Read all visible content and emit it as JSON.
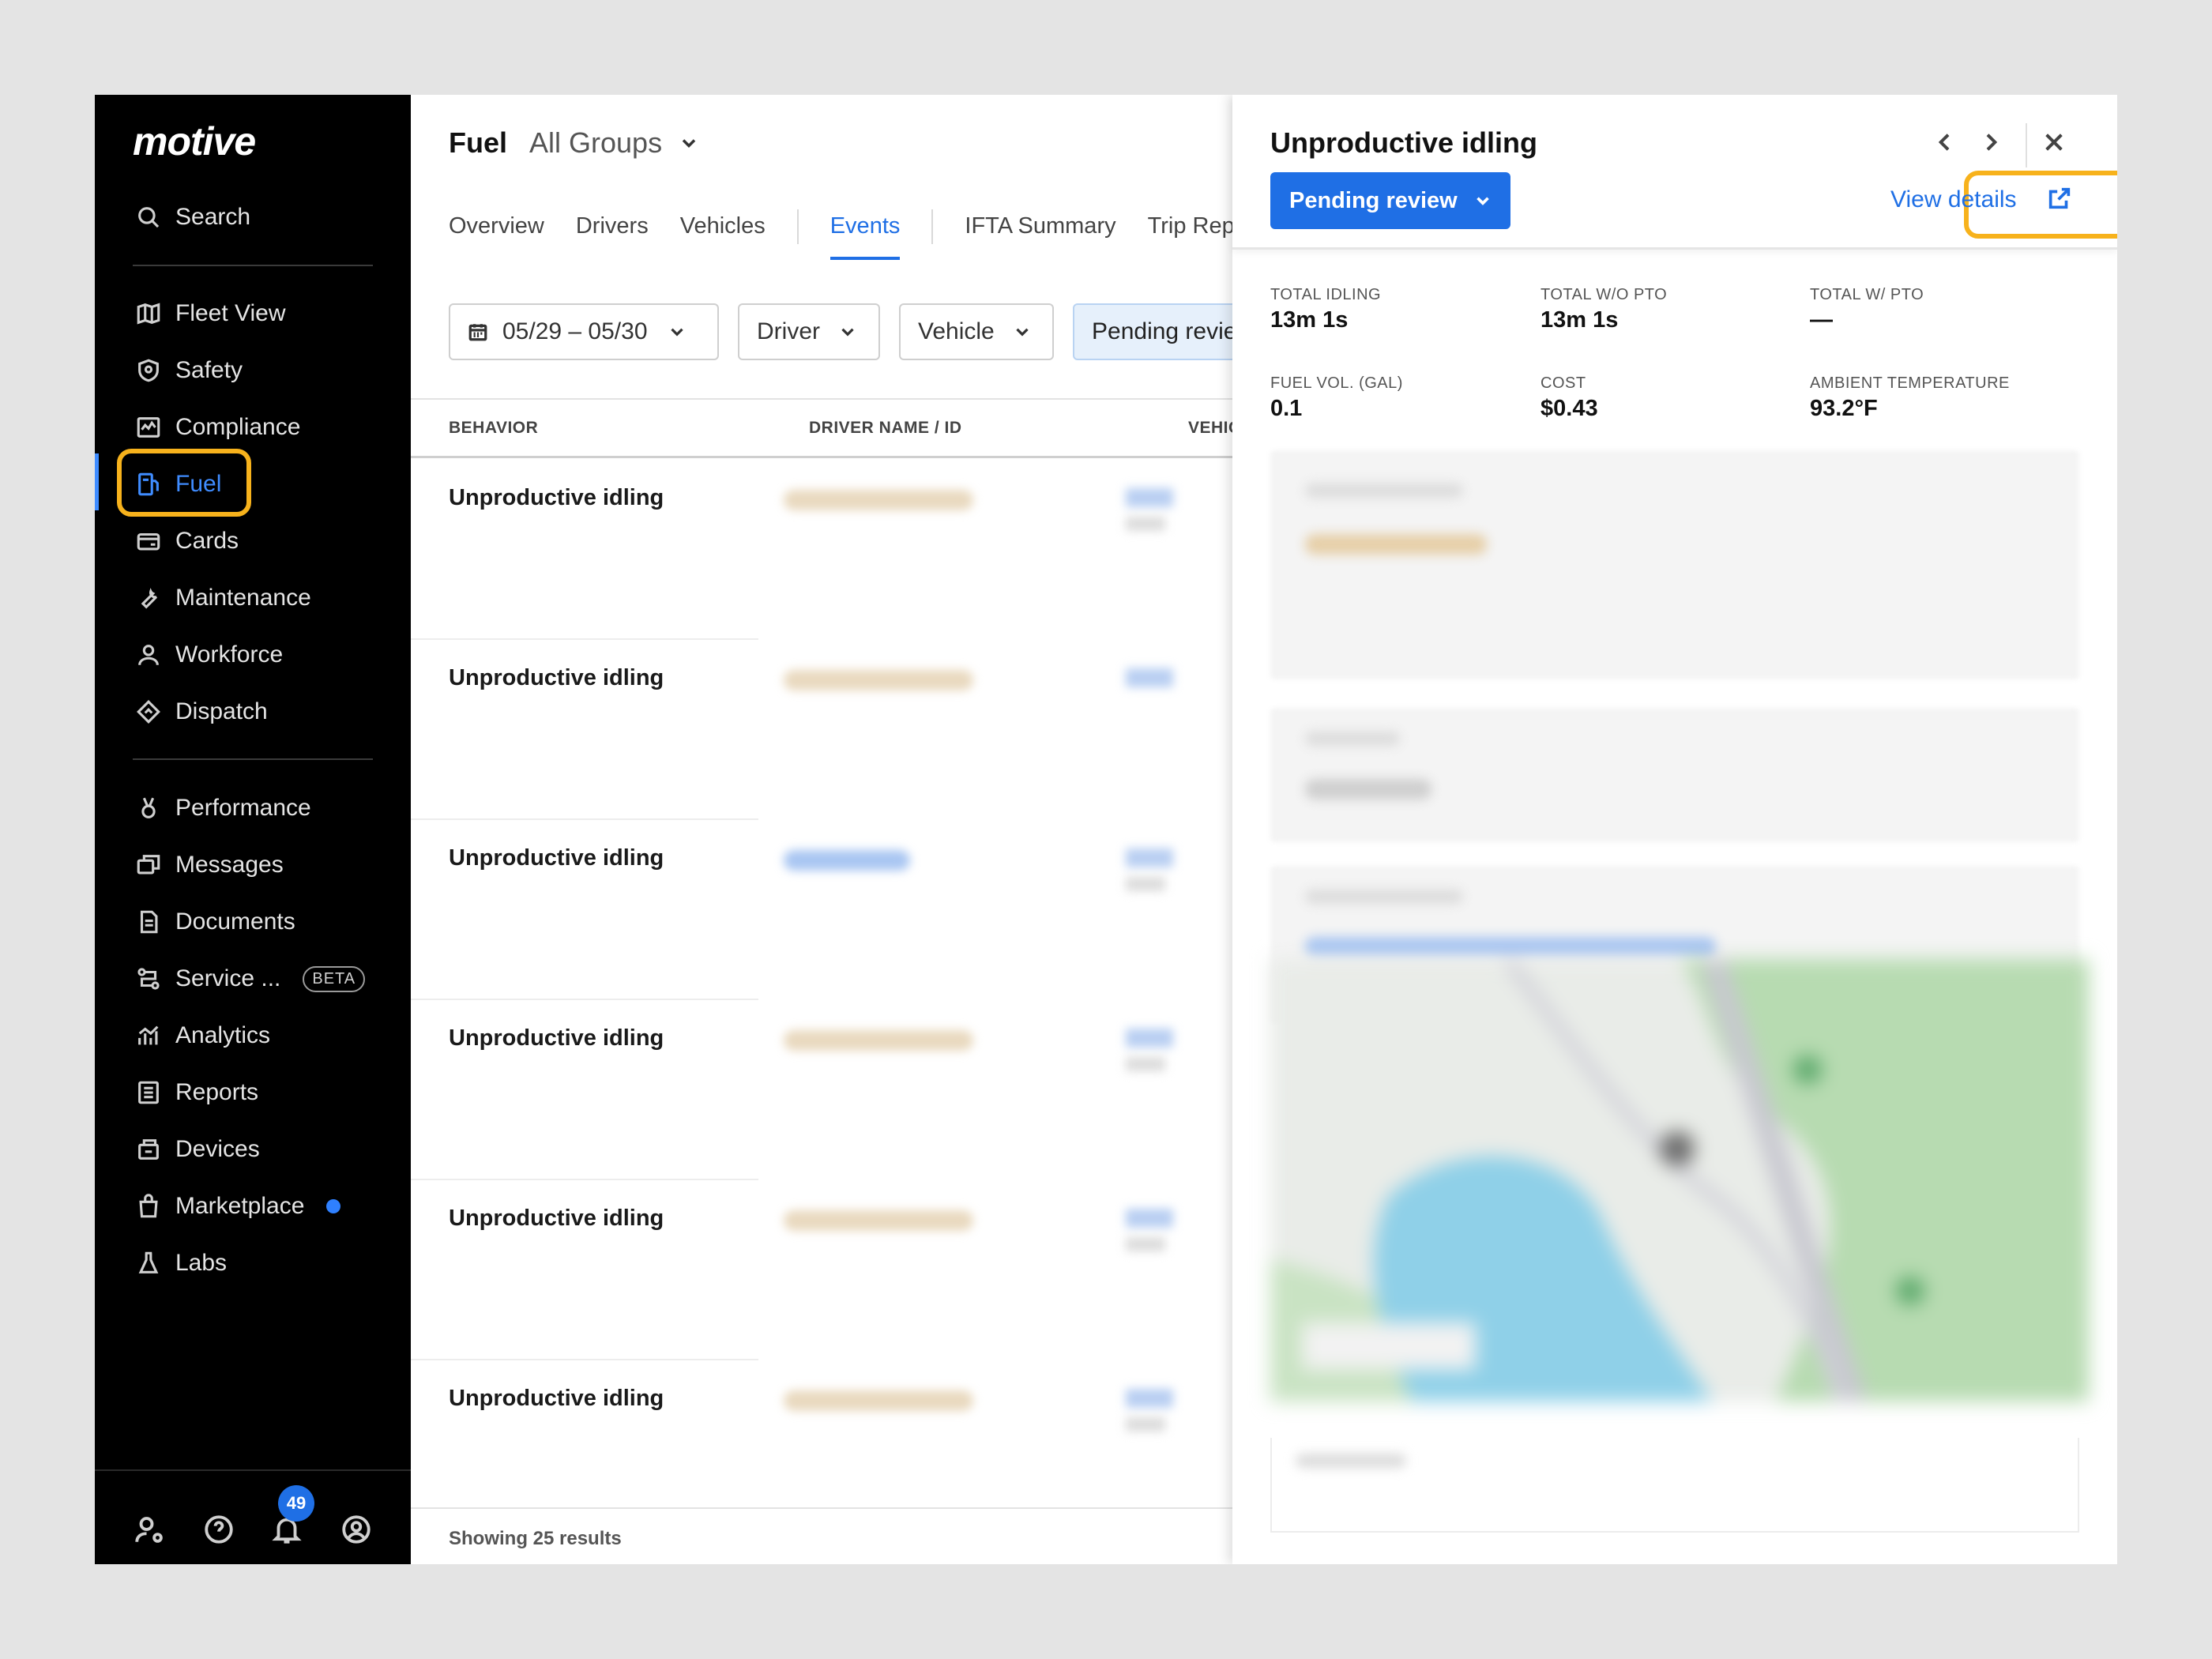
{
  "app": {
    "logo": "motive"
  },
  "sidebar": {
    "search_label": "Search",
    "items": [
      {
        "label": "Fleet View",
        "icon": "map-icon"
      },
      {
        "label": "Safety",
        "icon": "shield-icon"
      },
      {
        "label": "Compliance",
        "icon": "compliance-icon"
      },
      {
        "label": "Fuel",
        "icon": "fuel-pump-icon",
        "active": true
      },
      {
        "label": "Cards",
        "icon": "card-icon"
      },
      {
        "label": "Maintenance",
        "icon": "wrench-icon"
      },
      {
        "label": "Workforce",
        "icon": "person-icon"
      },
      {
        "label": "Dispatch",
        "icon": "dispatch-icon"
      },
      {
        "label": "Performance",
        "icon": "medal-icon"
      },
      {
        "label": "Messages",
        "icon": "chat-icon"
      },
      {
        "label": "Documents",
        "icon": "document-icon"
      },
      {
        "label": "Service ...",
        "icon": "service-icon",
        "badge": "BETA"
      },
      {
        "label": "Analytics",
        "icon": "analytics-icon"
      },
      {
        "label": "Reports",
        "icon": "report-icon"
      },
      {
        "label": "Devices",
        "icon": "device-icon"
      },
      {
        "label": "Marketplace",
        "icon": "bag-icon",
        "dot": true
      },
      {
        "label": "Labs",
        "icon": "flask-icon"
      }
    ],
    "notifications_count": "49"
  },
  "main": {
    "title": "Fuel",
    "group": "All Groups",
    "tabs": [
      "Overview",
      "Drivers",
      "Vehicles",
      "Events",
      "IFTA Summary",
      "Trip Rep"
    ],
    "active_tab": "Events",
    "filters": {
      "date_range": "05/29 – 05/30",
      "driver": "Driver",
      "vehicle": "Vehicle",
      "status": "Pending revie"
    },
    "columns": [
      "BEHAVIOR",
      "DRIVER NAME / ID",
      "VEHIC"
    ],
    "rows": [
      {
        "behavior": "Unproductive idling"
      },
      {
        "behavior": "Unproductive idling"
      },
      {
        "behavior": "Unproductive idling"
      },
      {
        "behavior": "Unproductive idling"
      },
      {
        "behavior": "Unproductive idling"
      },
      {
        "behavior": "Unproductive idling"
      }
    ],
    "footer": "Showing 25 results"
  },
  "panel": {
    "title": "Unproductive idling",
    "status": "Pending review",
    "view_details": "View details",
    "stats": [
      {
        "label": "TOTAL IDLING",
        "value": "13m 1s"
      },
      {
        "label": "TOTAL W/O PTO",
        "value": "13m 1s"
      },
      {
        "label": "TOTAL W/ PTO",
        "value": "—"
      },
      {
        "label": "FUEL VOL. (GAL)",
        "value": "0.1"
      },
      {
        "label": "COST",
        "value": "$0.43"
      },
      {
        "label": "AMBIENT TEMPERATURE",
        "value": "93.2°F"
      }
    ]
  },
  "colors": {
    "accent": "#1f6fe5",
    "highlight": "#f7b21c",
    "sidebar_bg": "#000000"
  }
}
